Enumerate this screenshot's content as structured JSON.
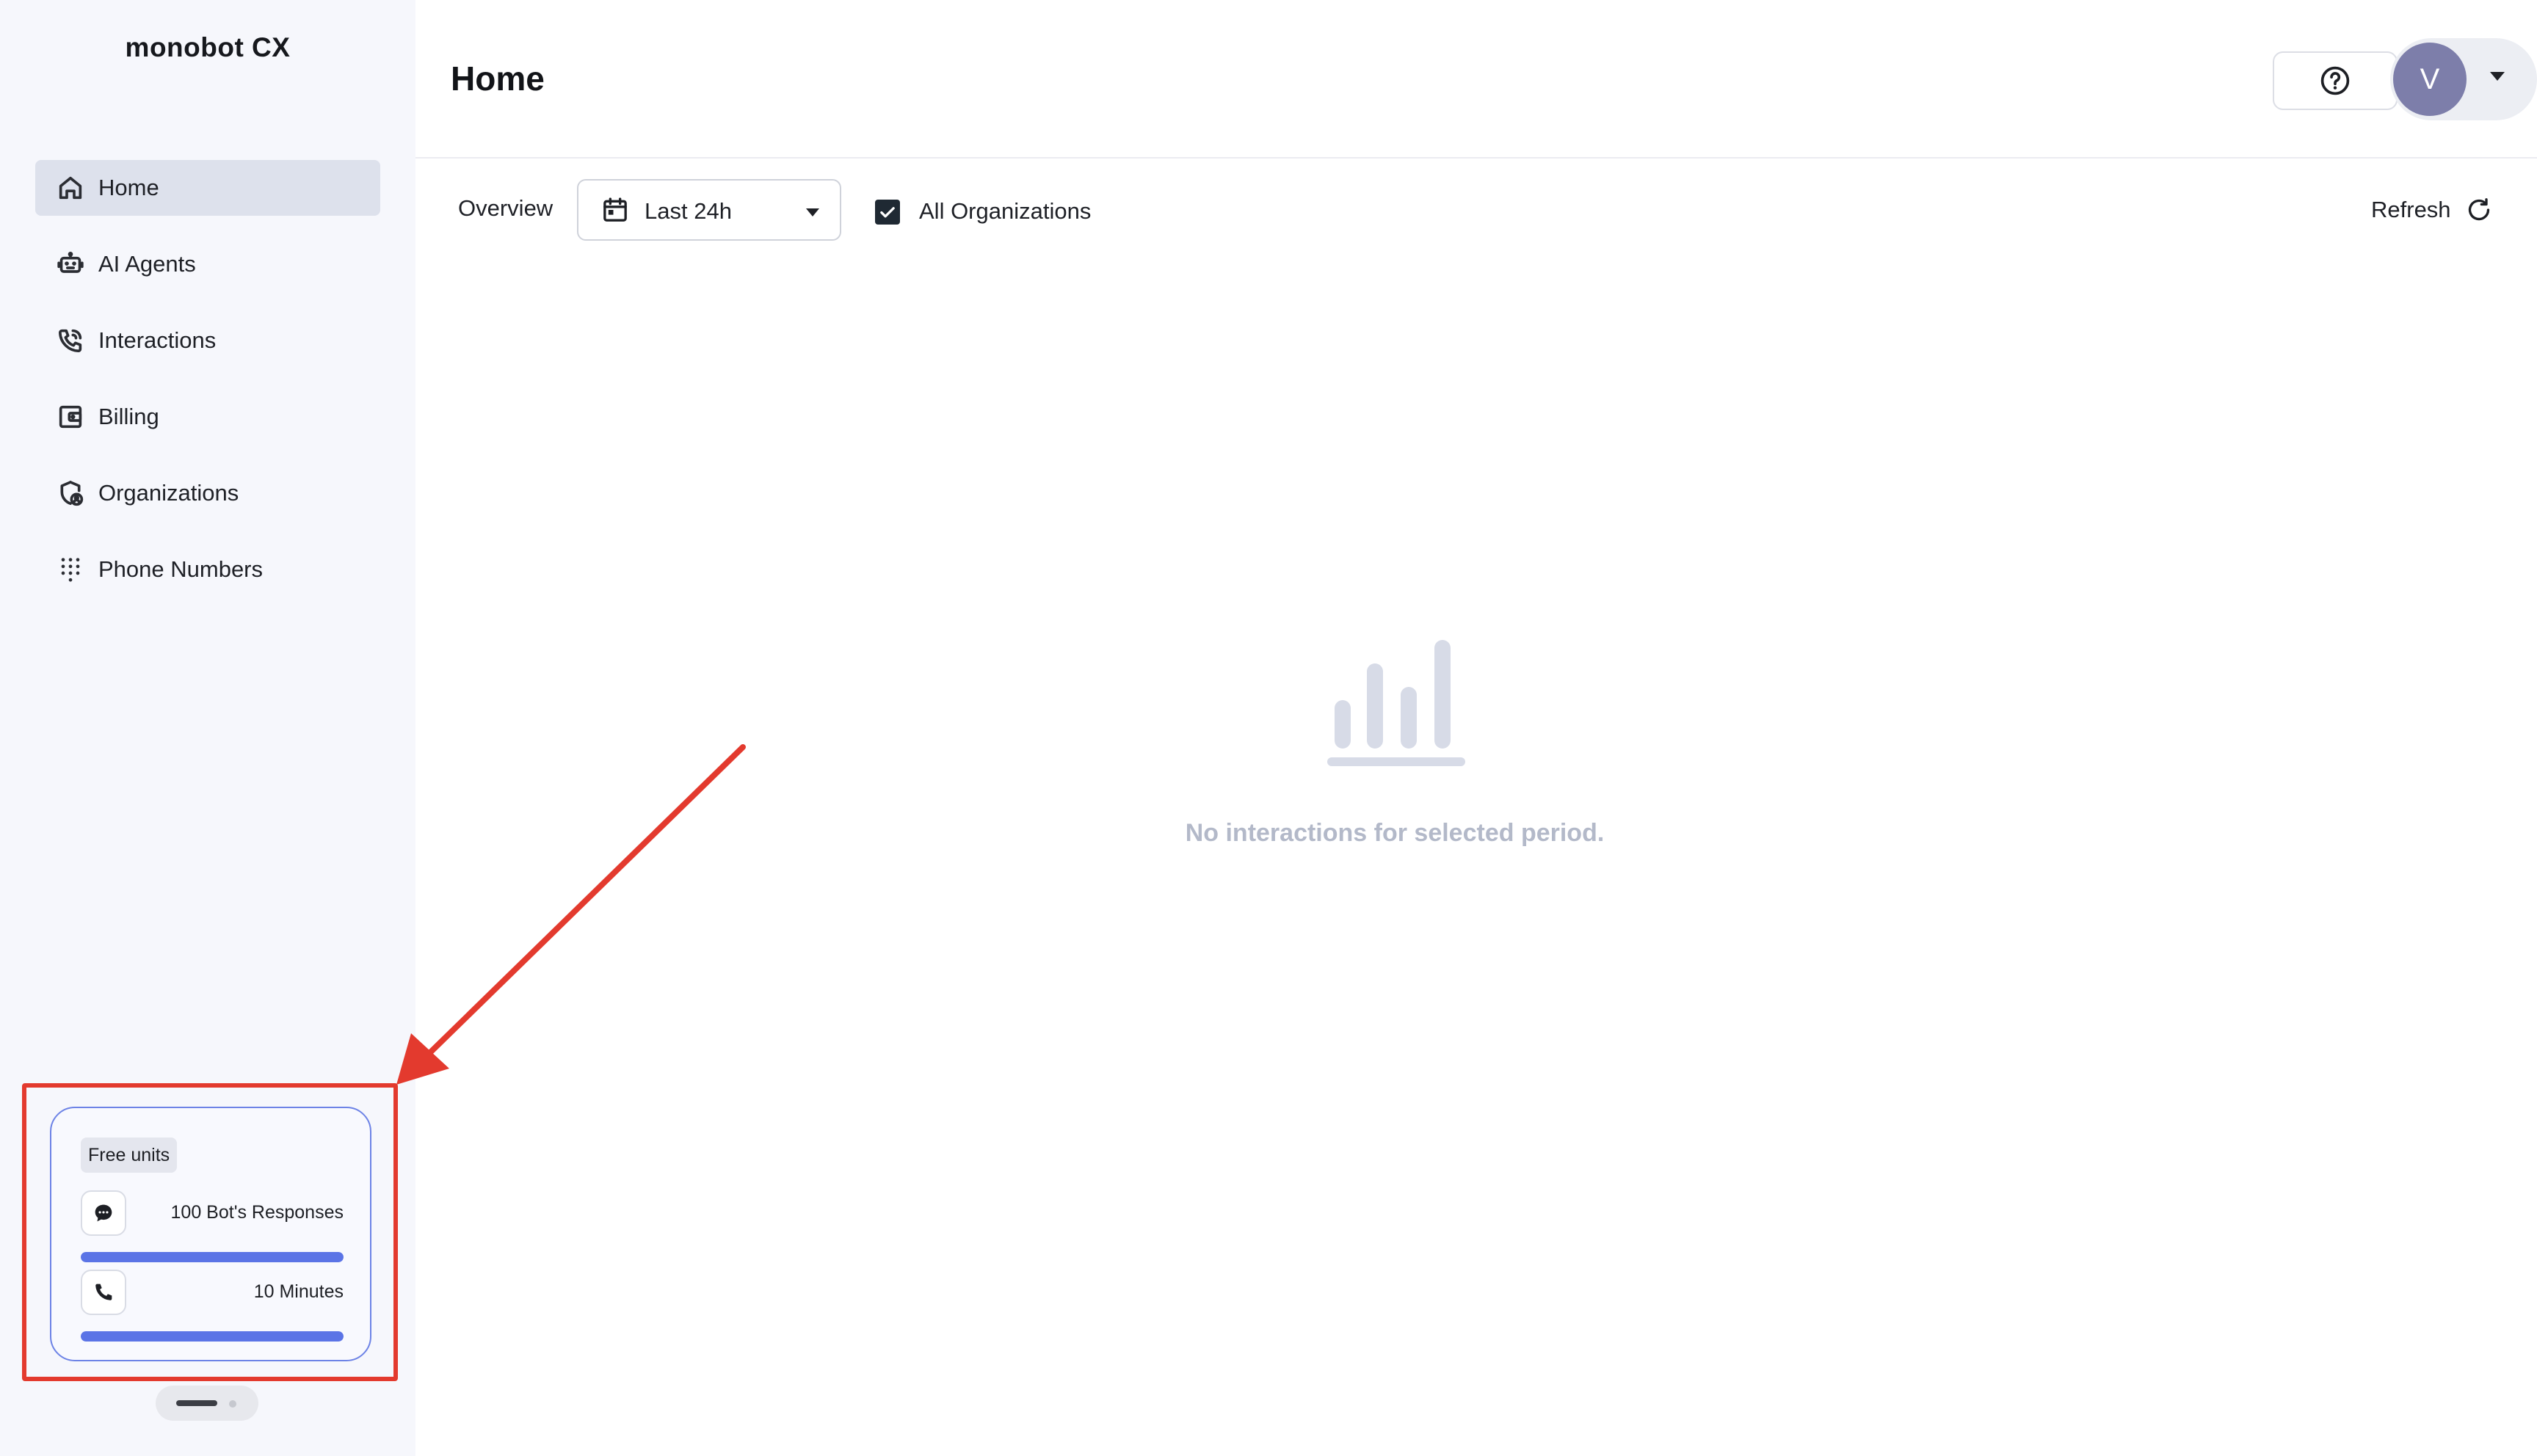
{
  "brand": "monobot CX",
  "sidebar": {
    "items": [
      {
        "label": "Home",
        "icon": "home-icon",
        "active": true
      },
      {
        "label": "AI Agents",
        "icon": "robot-icon",
        "active": false
      },
      {
        "label": "Interactions",
        "icon": "phone-icon",
        "active": false
      },
      {
        "label": "Billing",
        "icon": "wallet-icon",
        "active": false
      },
      {
        "label": "Organizations",
        "icon": "shield-user-icon",
        "active": false
      },
      {
        "label": "Phone Numbers",
        "icon": "dialpad-icon",
        "active": false
      }
    ],
    "free_units": {
      "tag": "Free units",
      "items": [
        {
          "label": "100 Bot's Responses",
          "icon": "chat-bubble-icon",
          "progress": 1.0
        },
        {
          "label": "10 Minutes",
          "icon": "phone-icon",
          "progress": 1.0
        }
      ]
    }
  },
  "header": {
    "title": "Home",
    "avatar_initial": "V"
  },
  "toolbar": {
    "overview_label": "Overview",
    "range_value": "Last 24h",
    "all_orgs_label": "All Organizations",
    "all_orgs_checked": true,
    "refresh_label": "Refresh"
  },
  "main": {
    "empty_message": "No interactions for selected period."
  },
  "colors": {
    "accent": "#5b74e6",
    "sidebar_bg": "#f6f7fc",
    "active_item_bg": "#dde1ec",
    "annotation_red": "#e33a2e",
    "empty_text": "#b3b9c9",
    "avatar_bg": "#7d7eaa"
  }
}
